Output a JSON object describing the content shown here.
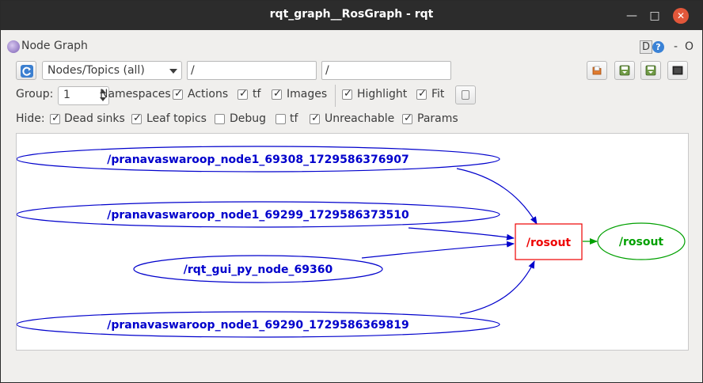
{
  "window": {
    "title": "rqt_graph__RosGraph - rqt",
    "minimize_icon": "minimize-icon",
    "maximize_icon": "maximize-icon",
    "close_icon": "close-icon"
  },
  "panel": {
    "icon": "node-graph-icon",
    "title": "Node Graph",
    "d_label": "D",
    "help_icon": "help-icon",
    "help_glyph": "?",
    "dash_label": "-",
    "o_label": "O"
  },
  "toolbar": {
    "refresh_icon": "refresh-icon",
    "graph_type": "Nodes/Topics (all)",
    "node_filter": "/",
    "topic_filter": "/",
    "load_icon": "load-icon",
    "save_dot_icon": "save-dot-icon",
    "save_svg_icon": "save-svg-icon",
    "save_image_icon": "save-image-icon"
  },
  "options": {
    "group_label": "Group:",
    "group_value": "1",
    "items": [
      {
        "label": "Namespaces",
        "checked": true
      },
      {
        "label": "Actions",
        "checked": true
      },
      {
        "label": "tf",
        "checked": true
      },
      {
        "label": "Images",
        "checked": true
      },
      {
        "label": "Highlight",
        "checked": true
      },
      {
        "label": "Fit",
        "checked": true
      }
    ],
    "fit_button_icon": "fit-icon"
  },
  "hide": {
    "label": "Hide:",
    "items": [
      {
        "label": "Dead sinks",
        "checked": true
      },
      {
        "label": "Leaf topics",
        "checked": true
      },
      {
        "label": "Debug",
        "checked": false
      },
      {
        "label": "tf",
        "checked": false
      },
      {
        "label": "Unreachable",
        "checked": true
      },
      {
        "label": "Params",
        "checked": true
      }
    ]
  },
  "graph": {
    "nodes": [
      {
        "name": "/pranavaswaroop_node1_69308_1729586376907",
        "kind": "node",
        "color": "#0000cc"
      },
      {
        "name": "/pranavaswaroop_node1_69299_1729586373510",
        "kind": "node",
        "color": "#0000cc"
      },
      {
        "name": "/rqt_gui_py_node_69360",
        "kind": "node",
        "color": "#0000cc"
      },
      {
        "name": "/pranavaswaroop_node1_69290_1729586369819",
        "kind": "node",
        "color": "#0000cc"
      },
      {
        "name": "/rosout",
        "kind": "topic",
        "color": "#ee0000"
      },
      {
        "name": "/rosout",
        "kind": "node",
        "color": "#00a000"
      }
    ],
    "edges": [
      {
        "from": 0,
        "to": 4
      },
      {
        "from": 1,
        "to": 4
      },
      {
        "from": 2,
        "to": 4
      },
      {
        "from": 3,
        "to": 4
      },
      {
        "from": 4,
        "to": 5
      }
    ]
  }
}
